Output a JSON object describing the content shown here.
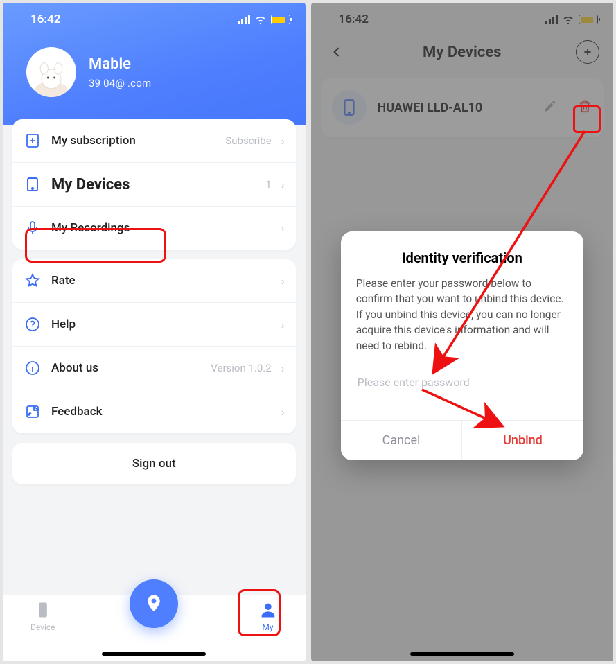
{
  "statusbar": {
    "time": "16:42"
  },
  "profile": {
    "name": "Mable",
    "email": "39       04@    .com"
  },
  "menu": {
    "subscription": {
      "label": "My subscription",
      "hint": "Subscribe"
    },
    "devices": {
      "label": "My Devices",
      "count": "1"
    },
    "recordings": {
      "label": "My Recordings"
    },
    "rate": {
      "label": "Rate"
    },
    "help": {
      "label": "Help"
    },
    "about": {
      "label": "About us",
      "hint": "Version 1.0.2"
    },
    "feedback": {
      "label": "Feedback"
    }
  },
  "signout_label": "Sign out",
  "tabbar": {
    "device": "Device",
    "my": "My"
  },
  "right": {
    "title": "My Devices",
    "device_name": "HUAWEI LLD-AL10",
    "modal": {
      "title": "Identity verification",
      "text": "Please enter your password below to confirm that you want to unbind this device. If you unbind this device, you can no longer acquire this device's information and will need to rebind.",
      "placeholder": "Please enter password",
      "cancel": "Cancel",
      "unbind": "Unbind"
    }
  }
}
